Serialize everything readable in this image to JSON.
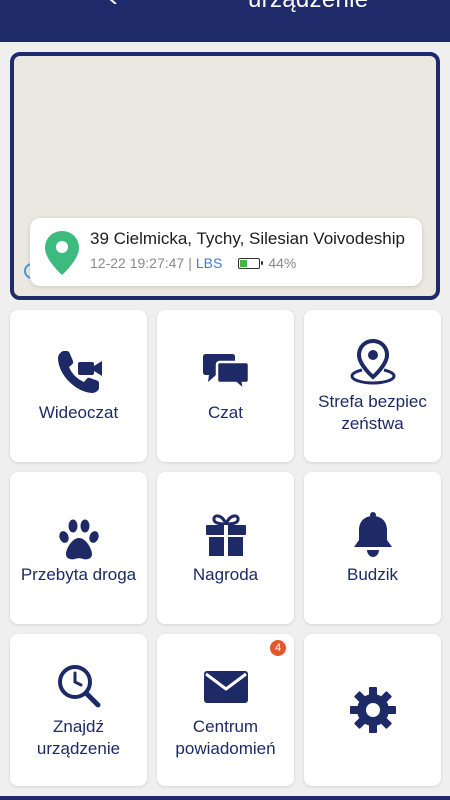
{
  "header": {
    "title": "urządzenie"
  },
  "location": {
    "address": "39 Cielmicka, Tychy, Silesian Voivodeship",
    "datetime": "12-22 19:27:47",
    "separator": "|",
    "source": "LBS",
    "battery_text": "44%",
    "battery_level": 0.44
  },
  "tiles": [
    {
      "label": "Wideoczat",
      "icon": "video-call-icon"
    },
    {
      "label": "Czat",
      "icon": "chat-icon"
    },
    {
      "label": "Strefa bezpieczeństwa",
      "label_line1": "Strefa bezpiec",
      "label_line2": "zeństwa",
      "icon": "safe-zone-pin-icon"
    },
    {
      "label": "Przebyta droga",
      "icon": "paw-icon"
    },
    {
      "label": "Nagroda",
      "icon": "gift-icon"
    },
    {
      "label": "Budzik",
      "icon": "bell-icon"
    },
    {
      "label": "Znajdź urządzenie",
      "label_line1": "Znajdź",
      "label_line2": "urządzenie",
      "icon": "find-device-icon"
    },
    {
      "label": "Centrum powiadomień",
      "label_line1": "Centrum",
      "label_line2": "powiadomień",
      "icon": "envelope-icon",
      "badge": "4"
    },
    {
      "label": "",
      "icon": "gear-icon"
    }
  ],
  "colors": {
    "primary": "#1f2a6b",
    "icon": "#1e2a66",
    "pin": "#3dbb7e",
    "badge": "#e4572e",
    "battery": "#46b347",
    "lbs": "#3b7dd8"
  }
}
